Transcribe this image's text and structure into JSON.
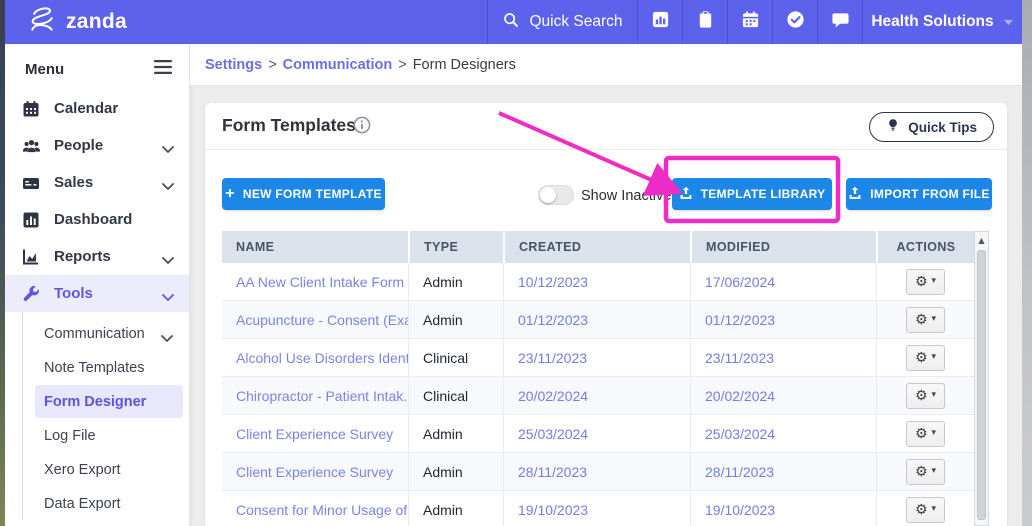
{
  "topbar": {
    "brand": "zanda",
    "quick_search_label": "Quick Search",
    "account_label": "Health Solutions",
    "toolbar_icons": [
      "search-icon",
      "stats-icon",
      "clipboard-icon",
      "calendar-icon",
      "check-circle-icon",
      "chat-icon"
    ]
  },
  "sidebar": {
    "title": "Menu",
    "items": [
      {
        "label": "Calendar",
        "icon": "calendar",
        "chevron": false
      },
      {
        "label": "People",
        "icon": "people",
        "chevron": true
      },
      {
        "label": "Sales",
        "icon": "sales",
        "chevron": true
      },
      {
        "label": "Dashboard",
        "icon": "dashboard",
        "chevron": false
      },
      {
        "label": "Reports",
        "icon": "reports",
        "chevron": true
      },
      {
        "label": "Tools",
        "icon": "wrench",
        "chevron": true
      }
    ],
    "subitems": [
      {
        "label": "Communication",
        "chevron": true
      },
      {
        "label": "Note Templates",
        "chevron": false
      },
      {
        "label": "Form Designer",
        "chevron": false
      },
      {
        "label": "Log File",
        "chevron": false
      },
      {
        "label": "Xero Export",
        "chevron": false
      },
      {
        "label": "Data Export",
        "chevron": false
      }
    ],
    "active_item": "Tools",
    "active_subitem": "Form Designer"
  },
  "breadcrumb": {
    "separator": ">",
    "links": [
      {
        "label": "Settings"
      },
      {
        "label": "Communication"
      }
    ],
    "current": "Form Designers"
  },
  "page": {
    "title": "Form Templates",
    "quick_tips_label": "Quick Tips",
    "show_inactive_label": "Show Inactive",
    "show_inactive_state": "off",
    "buttons": {
      "new_form_template": "NEW FORM TEMPLATE",
      "template_library": "TEMPLATE LIBRARY",
      "import_from_file": "IMPORT FROM FILE"
    },
    "annotation": "magenta arrow and box highlighting the TEMPLATE LIBRARY button"
  },
  "table": {
    "columns": [
      "NAME",
      "TYPE",
      "CREATED",
      "MODIFIED",
      "ACTIONS"
    ],
    "rows": [
      {
        "name": "AA New Client Intake Form",
        "type": "Admin",
        "created": "10/12/2023",
        "modified": "17/06/2024"
      },
      {
        "name": "Acupuncture - Consent (Exa...",
        "type": "Admin",
        "created": "01/12/2023",
        "modified": "01/12/2023"
      },
      {
        "name": "Alcohol Use Disorders Ident...",
        "type": "Clinical",
        "created": "23/11/2023",
        "modified": "23/11/2023"
      },
      {
        "name": "Chiropractor - Patient Intak...",
        "type": "Clinical",
        "created": "20/02/2024",
        "modified": "20/02/2024"
      },
      {
        "name": "Client Experience Survey",
        "type": "Admin",
        "created": "25/03/2024",
        "modified": "25/03/2024"
      },
      {
        "name": "Client Experience Survey",
        "type": "Admin",
        "created": "28/11/2023",
        "modified": "28/11/2023"
      },
      {
        "name": "Consent for Minor Usage of...",
        "type": "Admin",
        "created": "19/10/2023",
        "modified": "19/10/2023"
      }
    ]
  },
  "icons": {
    "plus": "+",
    "gear": "⚙",
    "caret_small": "▾",
    "scroll_up_arrow": "▲"
  },
  "colors": {
    "topbar": "#5d62ec",
    "primary_button": "#1d87e8",
    "annotation": "#ee2cc6",
    "link": "#6a6fe2",
    "active_nav": "#5f55e3",
    "table_header_bg": "#dbe2eb"
  }
}
